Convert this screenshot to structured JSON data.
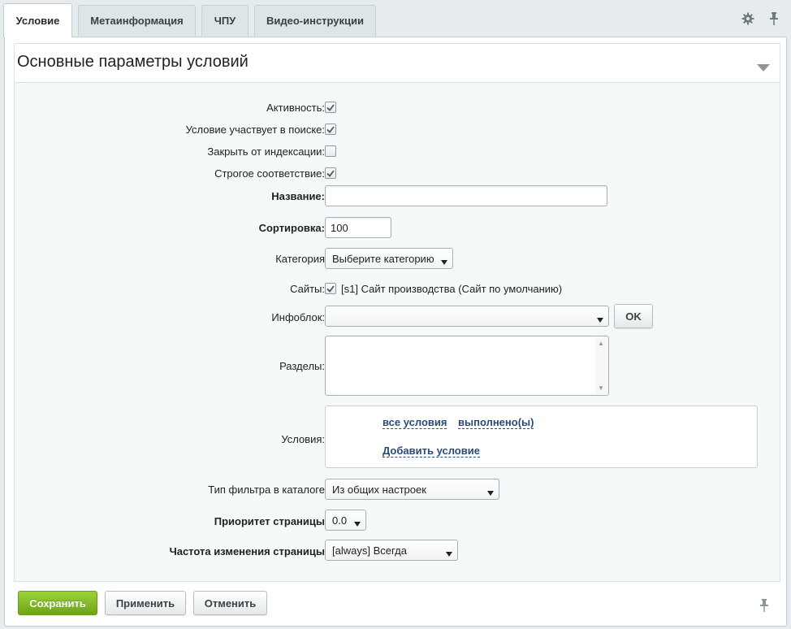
{
  "tabs": [
    {
      "label": "Условие",
      "active": true
    },
    {
      "label": "Метаинформация",
      "active": false
    },
    {
      "label": "ЧПУ",
      "active": false
    },
    {
      "label": "Видео-инструкции",
      "active": false
    }
  ],
  "section": {
    "title": "Основные параметры условий"
  },
  "form": {
    "active_label": "Активность:",
    "active_checked": true,
    "search_label": "Условие участвует в поиске:",
    "search_checked": true,
    "noindex_label": "Закрыть от индексации:",
    "noindex_checked": false,
    "strict_label": "Строгое соответствие:",
    "strict_checked": true,
    "name_label": "Название:",
    "name_value": "",
    "sort_label": "Сортировка:",
    "sort_value": "100",
    "category_label": "Категория",
    "category_selected": "Выберите категорию",
    "sites_label": "Сайты:",
    "sites_option": "[s1] Сайт производства (Сайт по умолчанию)",
    "sites_checked": true,
    "iblock_label": "Инфоблок:",
    "iblock_selected": "",
    "iblock_ok": "OK",
    "sections_label": "Разделы:",
    "conditions_label": "Условия:",
    "cond_all": "все условия",
    "cond_done": "выполнено(ы)",
    "cond_add": "Добавить условие",
    "filter_type_label": "Тип фильтра в каталоге",
    "filter_type_selected": "Из общих настроек",
    "priority_label": "Приоритет страницы",
    "priority_selected": "0.0",
    "freq_label": "Частота изменения страницы",
    "freq_selected": "[always] Всегда"
  },
  "buttons": {
    "save": "Сохранить",
    "apply": "Применить",
    "cancel": "Отменить"
  },
  "icons": {
    "settings": "gear-icon",
    "pin": "pin-icon",
    "collapse": "triangle-down-icon"
  },
  "colors": {
    "save_button": "#7ab51d",
    "link": "#2a4b74",
    "background": "#e6ebed"
  }
}
